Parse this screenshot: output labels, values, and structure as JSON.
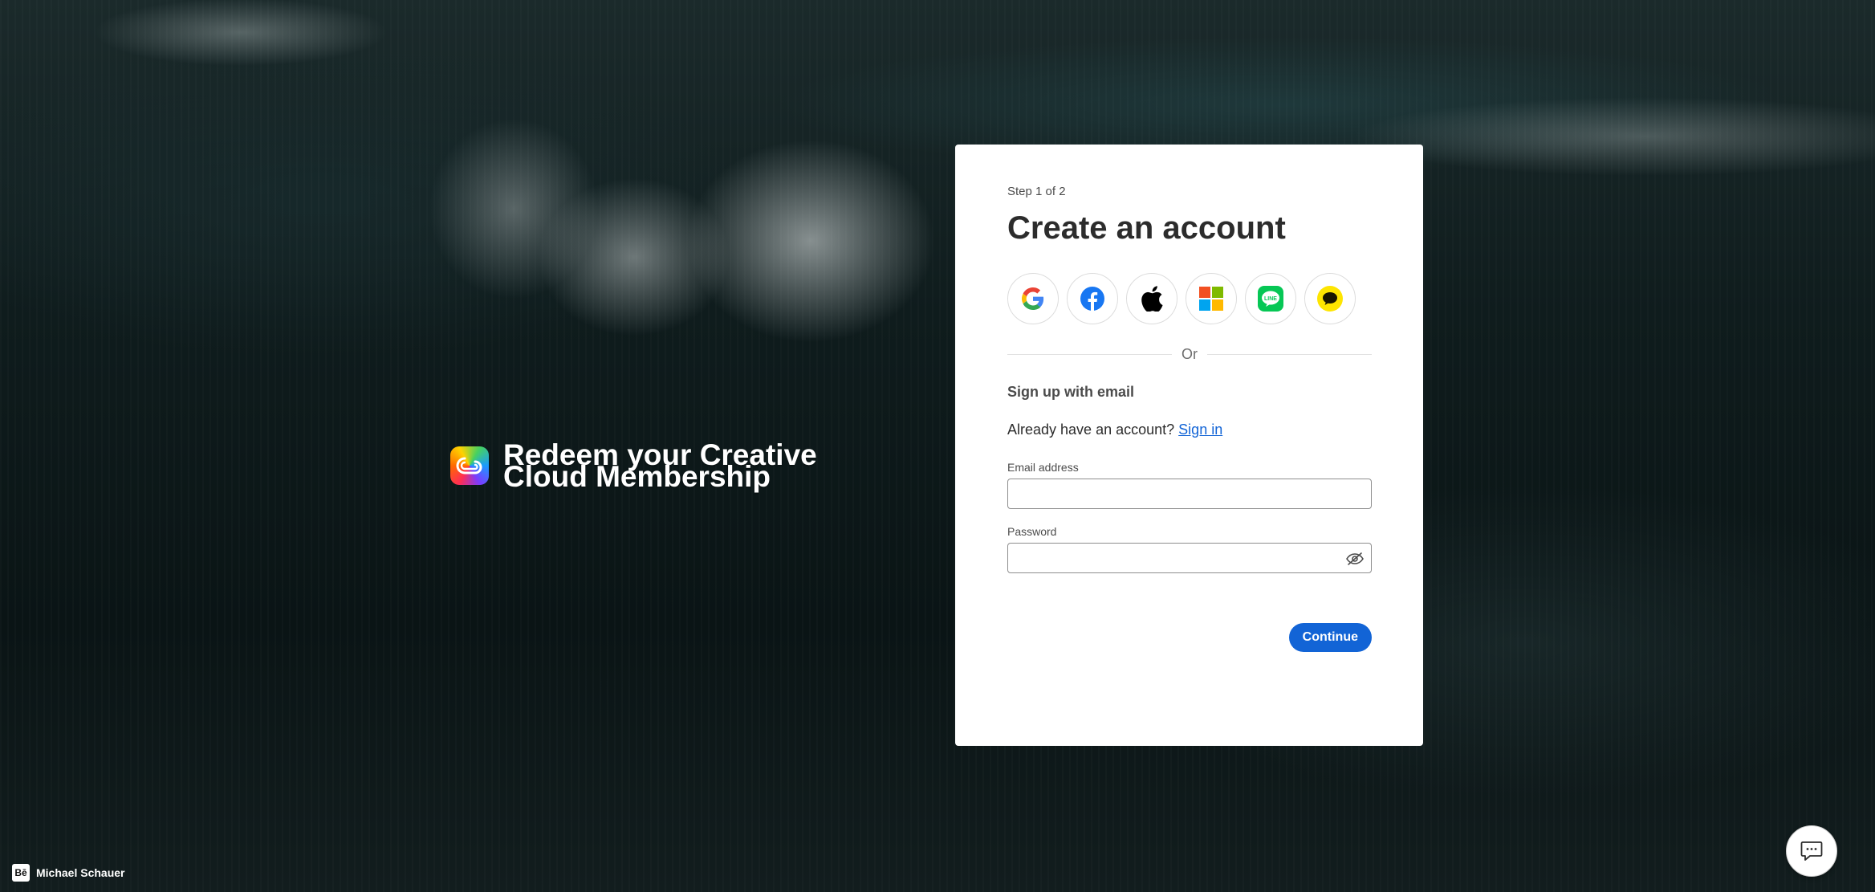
{
  "background": {
    "description_colors": {
      "deep": "#0d1616",
      "foam": "#e6ebeb"
    }
  },
  "promo": {
    "logo_icon": "creative-cloud-logo-icon",
    "title": "Redeem your Creative Cloud Membership"
  },
  "card": {
    "step": "Step 1 of 2",
    "title": "Create an account",
    "social_buttons": [
      {
        "name": "google",
        "icon": "google-icon"
      },
      {
        "name": "facebook",
        "icon": "facebook-icon"
      },
      {
        "name": "apple",
        "icon": "apple-icon"
      },
      {
        "name": "microsoft",
        "icon": "microsoft-icon"
      },
      {
        "name": "line",
        "icon": "line-icon"
      },
      {
        "name": "kakao",
        "icon": "kakao-icon"
      }
    ],
    "divider_text": "Or",
    "subheading": "Sign up with email",
    "signin_prompt": "Already have an account?",
    "signin_link": "Sign in",
    "email": {
      "label": "Email address",
      "value": "",
      "placeholder": ""
    },
    "password": {
      "label": "Password",
      "value": "",
      "placeholder": "",
      "toggle_icon": "eye-hidden-icon"
    },
    "continue_label": "Continue",
    "accent_color": "#1264d6"
  },
  "footer": {
    "behance_icon": "behance-icon",
    "behance_text": "Bē",
    "credit_name": "Michael Schauer"
  },
  "chat": {
    "icon": "chat-bubble-icon"
  }
}
